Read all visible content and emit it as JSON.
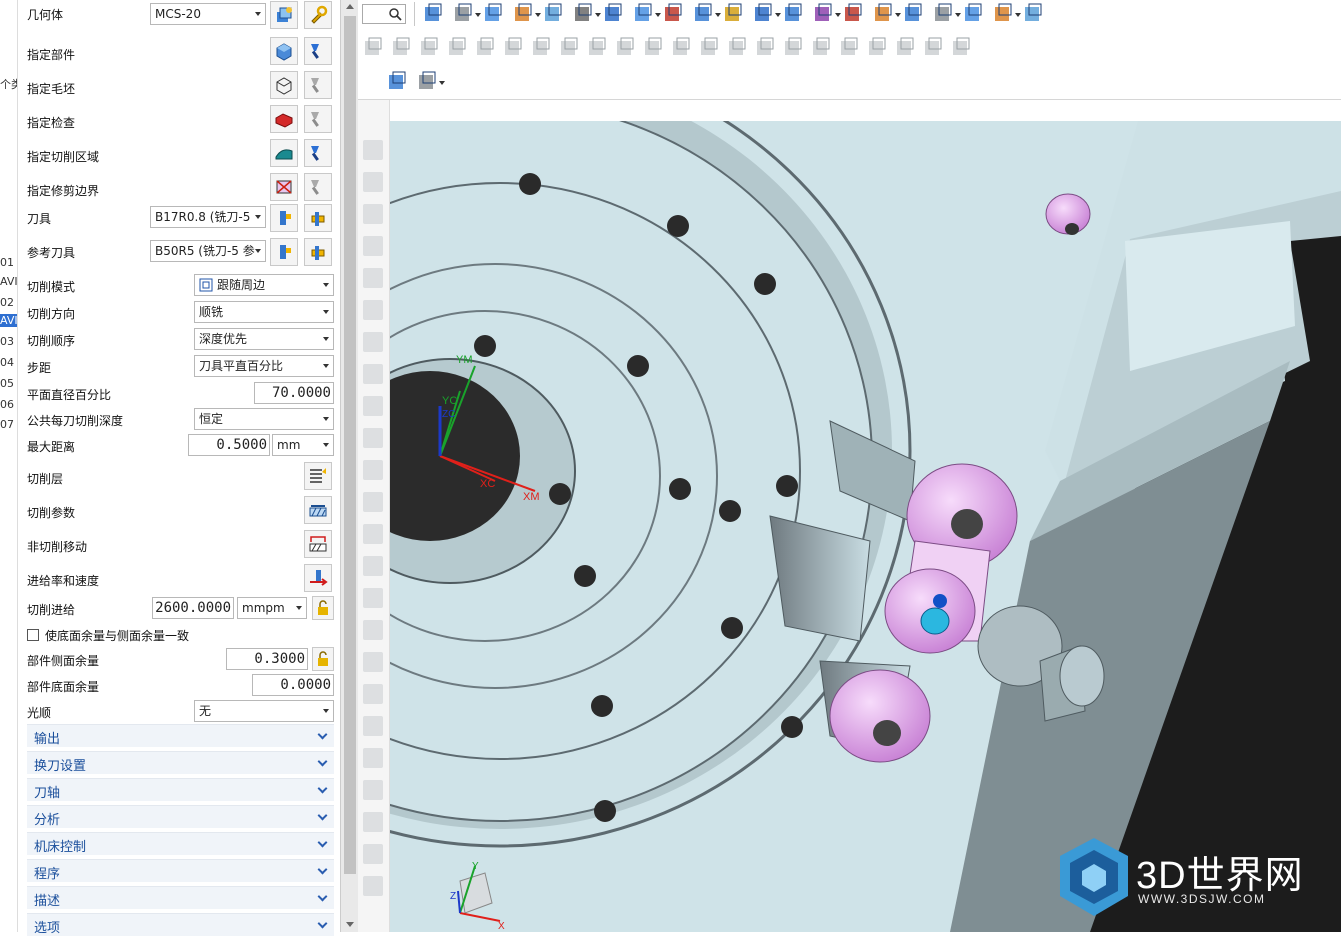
{
  "left_strip": {
    "items": [
      {
        "label": "个类",
        "highlight": false
      },
      {
        "label": "01",
        "highlight": false
      },
      {
        "label": "AVI",
        "highlight": false
      },
      {
        "label": "02",
        "highlight": false
      },
      {
        "label": "AVI",
        "highlight": true
      },
      {
        "label": "03",
        "highlight": false
      },
      {
        "label": "04",
        "highlight": false
      },
      {
        "label": "05",
        "highlight": false
      },
      {
        "label": "06",
        "highlight": false
      },
      {
        "label": "07",
        "highlight": false
      }
    ]
  },
  "panel": {
    "geometry_label": "几何体",
    "geometry_value": "MCS-20",
    "specify_part": "指定部件",
    "specify_blank": "指定毛坯",
    "specify_check": "指定检查",
    "specify_cut_area": "指定切削区域",
    "specify_trim_boundary": "指定修剪边界",
    "tool_label": "刀具",
    "tool_value": "B17R0.8 (铣刀-5",
    "ref_tool_label": "参考刀具",
    "ref_tool_value": "B50R5 (铣刀-5 参",
    "cut_pattern_label": "切削模式",
    "cut_pattern_value": "跟随周边",
    "cut_direction_label": "切削方向",
    "cut_direction_value": "顺铣",
    "cut_order_label": "切削顺序",
    "cut_order_value": "深度优先",
    "stepover_label": "步距",
    "stepover_value": "刀具平直百分比",
    "flat_pct_label": "平面直径百分比",
    "flat_pct_value": "70.0000",
    "depth_per_cut_label": "公共每刀切削深度",
    "depth_per_cut_value": "恒定",
    "max_distance_label": "最大距离",
    "max_distance_value": "0.5000",
    "max_distance_unit": "mm",
    "cut_levels_label": "切削层",
    "cut_params_label": "切削参数",
    "non_cutting_label": "非切削移动",
    "feeds_speeds_label": "进给率和速度",
    "cut_feed_label": "切削进给",
    "cut_feed_value": "2600.0000",
    "cut_feed_unit": "mmpm",
    "same_stock_label": "使底面余量与侧面余量一致",
    "side_stock_label": "部件侧面余量",
    "side_stock_value": "0.3000",
    "floor_stock_label": "部件底面余量",
    "floor_stock_value": "0.0000",
    "smoothing_label": "光顺",
    "smoothing_value": "无",
    "sections": [
      "输出",
      "换刀设置",
      "刀轴",
      "分析",
      "机床控制",
      "程序",
      "描述",
      "选项"
    ]
  },
  "viewport": {
    "axis_labels": {
      "ym": "YM",
      "yc": "YC",
      "xc": "XC",
      "xm": "XM",
      "zc": "ZC"
    },
    "triad_labels": {
      "x": "X",
      "y": "Y",
      "z": "Z"
    }
  },
  "watermark": {
    "title": "3D世界网",
    "url": "WWW.3DSJW.COM"
  },
  "icons": [
    "search-icon",
    "fit-view-icon",
    "shaded-cube-icon",
    "part-icon",
    "lock-icon"
  ],
  "colors": {
    "panel_section_text": "#1b4f9c",
    "part_surface": "#cfe3e8",
    "highlight_pink": "#e7b6ee",
    "viewport_bg": "#1c1c1c"
  }
}
